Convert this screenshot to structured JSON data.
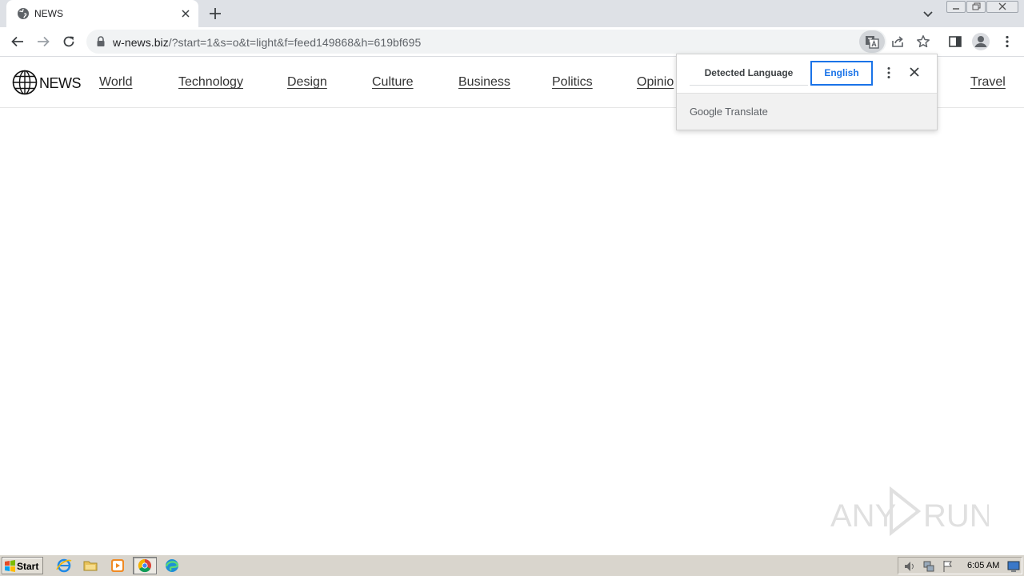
{
  "browser": {
    "tab": {
      "title": "NEWS"
    },
    "omnibox": {
      "url_host": "w-news.biz",
      "url_path": "/?start=1&s=o&t=light&f=feed149868&h=619bf695"
    }
  },
  "site": {
    "logo_text": "NEWS",
    "nav": [
      "World",
      "Technology",
      "Design",
      "Culture",
      "Business",
      "Politics",
      "Opinio",
      "Travel"
    ]
  },
  "translate_bubble": {
    "detected_label": "Detected Language",
    "target_label": "English",
    "brand_google": "Google",
    "brand_translate": "Translate"
  },
  "watermark": "ANY RUN",
  "taskbar": {
    "start_label": "Start",
    "clock": "6:05 AM"
  },
  "colors": {
    "accent_blue": "#1a73e8",
    "tabstrip_bg": "#dee1e6",
    "taskbar_bg": "#d9d5cd"
  },
  "icons": [
    "globe-icon",
    "close-icon",
    "plus-icon",
    "chevron-down-icon",
    "back-icon",
    "forward-icon",
    "reload-icon",
    "lock-icon",
    "translate-icon",
    "share-icon",
    "star-icon",
    "side-panel-icon",
    "profile-icon",
    "more-vert-icon",
    "ie-icon",
    "folder-icon",
    "media-icon",
    "chrome-icon",
    "edge-icon",
    "volume-icon",
    "network-icon",
    "flag-icon",
    "desktop-icon"
  ]
}
